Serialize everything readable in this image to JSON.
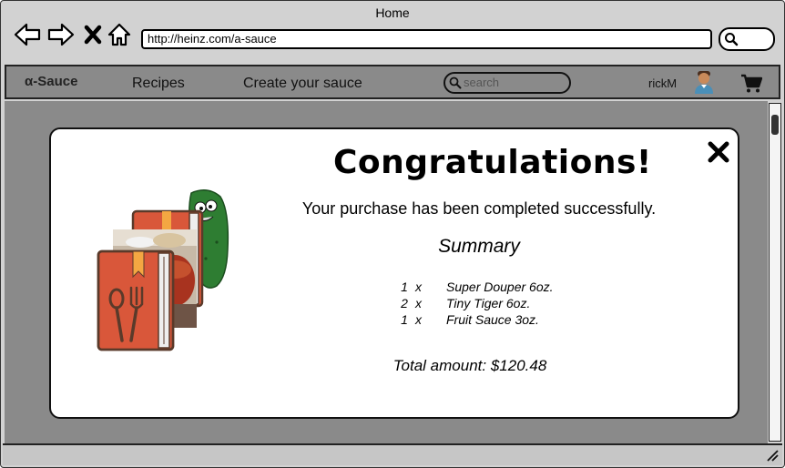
{
  "browser": {
    "title": "Home",
    "url": "http://heinz.com/a-sauce"
  },
  "appbar": {
    "brand": "α-Sauce",
    "nav": [
      "Recipes",
      "Create your sauce"
    ],
    "search_placeholder": "search",
    "username": "rickM"
  },
  "dialog": {
    "title": "Congratulations!",
    "message": "Your purchase has been completed successfully.",
    "summary_title": "Summary",
    "items": [
      {
        "qty": "1",
        "times": "x",
        "name": "Super Douper 6oz."
      },
      {
        "qty": "2",
        "times": "x",
        "name": "Tiny Tiger 6oz."
      },
      {
        "qty": "1",
        "times": "x",
        "name": "Fruit Sauce 3oz."
      }
    ],
    "total": "Total amount: $120.48"
  },
  "colors": {
    "book_orange": "#d9573a",
    "book_dark": "#5a3a2a",
    "pickle_green": "#2e7d32"
  }
}
